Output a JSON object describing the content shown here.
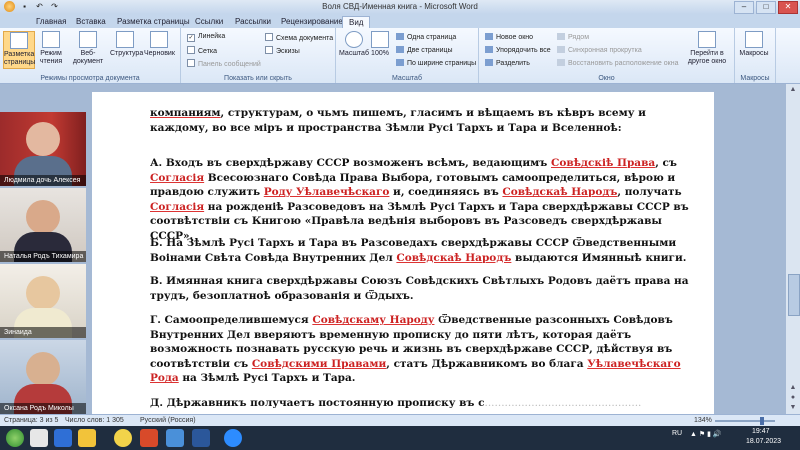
{
  "window": {
    "title": "Воля СВД-Именная книга - Microsoft Word"
  },
  "ribbon_tabs": [
    "Главная",
    "Вставка",
    "Разметка страницы",
    "Ссылки",
    "Рассылки",
    "Рецензирование",
    "Вид"
  ],
  "ribbon": {
    "views_group": {
      "label": "Режимы просмотра документа",
      "buttons": [
        "Разметка страницы",
        "Режим чтения",
        "Веб-документ",
        "Структура",
        "Черновик"
      ]
    },
    "show_group": {
      "label": "Показать или скрыть",
      "checks": [
        {
          "label": "Линейка",
          "checked": true
        },
        {
          "label": "Схема документа",
          "checked": false
        },
        {
          "label": "Сетка",
          "checked": false
        },
        {
          "label": "Эскизы",
          "checked": false
        },
        {
          "label": "Панель сообщений",
          "checked": false
        }
      ]
    },
    "zoom_group": {
      "label": "Масштаб",
      "buttons": [
        "Масштаб",
        "100%"
      ],
      "options": [
        "Одна страница",
        "Две страницы",
        "По ширине страницы"
      ]
    },
    "window_group": {
      "label": "Окно",
      "buttons": [
        "Новое окно",
        "Упорядочить все",
        "Разделить",
        "Рядом",
        "Синхронная прокрутка",
        "Восстановить расположение окна"
      ],
      "switch_windows": "Перейти в другое окно"
    },
    "macros_group": {
      "label": "Макросы",
      "button": "Макросы"
    }
  },
  "participants": [
    {
      "name": "Людмила дочь Алексея"
    },
    {
      "name": "Наталья Родъ Тихамира"
    },
    {
      "name": "Зинаида"
    },
    {
      "name": "Оксана Родъ Миколы"
    }
  ],
  "document": {
    "p0": {
      "t1": "компаниям",
      "t2": ", структурам, о чьмъ пишемъ, гласимъ и вѣщаемъ въ кѣвръ всему и каждому, во все міръ и пространства Зѣмли Русі Тархъ и Тара и Вселенноѣ:"
    },
    "p1": {
      "t1": "А. Входъ въ сверхдѣржаву СССР возможенъ всѣмъ, ведающимъ ",
      "r1": "Совѣдскіѣ Права",
      "t2": ", съ ",
      "r2": "Согласія",
      "t3": " Всесоюзнаго Совѣда Права Выбора, готовымъ самоопределиться, вѣрою и правдою служить ",
      "r3": "Роду Уѣлавечѣскаго",
      "t4": " и, соединяясь въ ",
      "r4": "Совѣдскаѣ Народъ",
      "t5": ", получать ",
      "r5": "Согласія",
      "t6": " на рожденіѣ Разсоведовъ на Зѣмлѣ Русі Тархъ и Тара сверхдѣржавы СССР въ соотвѣтствіи съ Книгою «Правѣла ведѣнія выборовъ въ Разсоведъ сверхдѣржавы СССР»."
    },
    "p2": {
      "t1": "Б. На Зѣмлѣ Русі Тархъ и Тара въ Разсоведахъ сверхдѣржавы СССР Ѿведственными Воінами Свѣта Совѣда Внутренних Дел ",
      "r1": "Совѣдскаѣ Народъ",
      "t2": " выдаются Имянныѣ книги."
    },
    "p3": {
      "t1": "В. Имянная книга сверхдѣржавы Союзъ Совѣдскихъ Свѣтлыхъ Родовъ даётъ права на трудъ, безоплатноѣ образованія и Ѿдыхъ."
    },
    "p4": {
      "t1": "Г. Самоопределившемуся ",
      "r1": "Совѣдскаму Народу",
      "t2": " Ѿведственные разсонныхъ Совѣдовъ Внутренних Дел вверяютъ временную прописку до пяти лѣтъ, которая даётъ возможность познавать русскую речь и жизнь въ сверхдѣржаве СССР, дѣйствуя въ соотвѣтствіи съ ",
      "r2": "Совѣдскими Правами",
      "t3": ", статъ Дѣржавникомъ во блага ",
      "r3": "Уѣлавечѣскаго Рода",
      "t4": " на Зѣмлѣ Русі Тархъ и Тара."
    },
    "p5": {
      "t1": "Д. Дѣржавникъ получаетъ постоянную прописку въ с"
    }
  },
  "statusbar": {
    "page": "Страница: 3 из 5",
    "words": "Число слов: 1 305",
    "language": "Русский (Россия)",
    "zoom": "134%"
  },
  "taskbar": {
    "lang": "RU",
    "time": "19:47",
    "date": "18.07.2023"
  },
  "colors": {
    "accent_red": "#c22",
    "ribbon_bg": "#dbe7f6"
  }
}
